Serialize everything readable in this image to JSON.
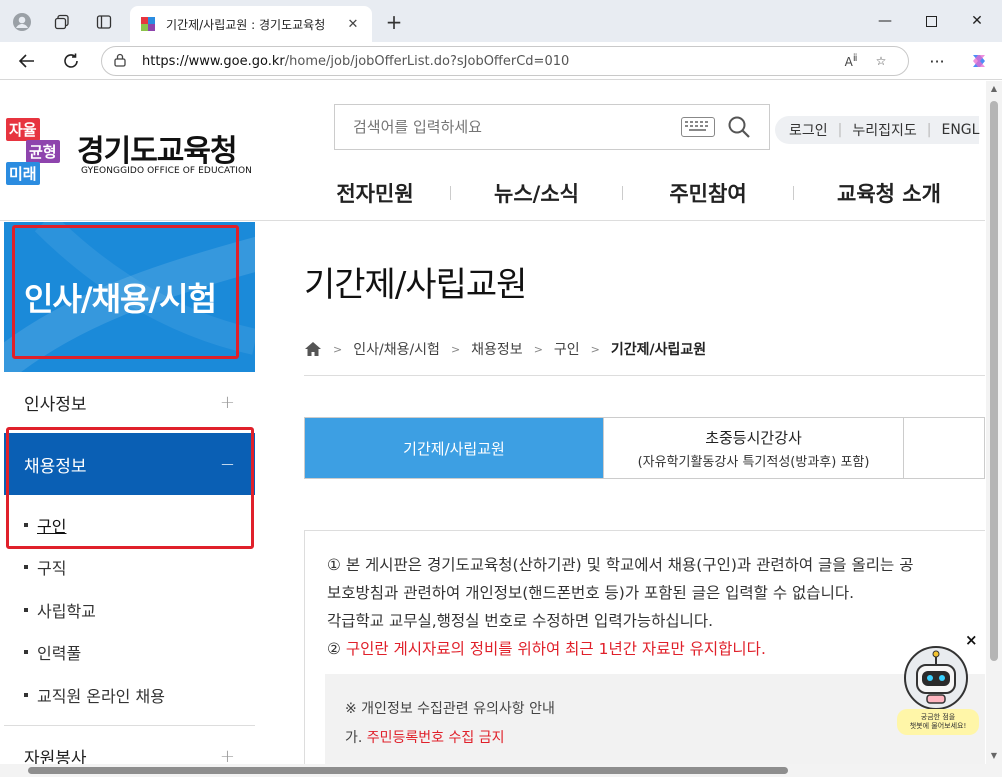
{
  "browser": {
    "tab_title": "기간제/사립교원 : 경기도교육청",
    "url_host": "https://www.goe.go.kr",
    "url_path": "/home/job/jobOfferList.do?sJobOfferCd=010"
  },
  "header": {
    "logo_badge": [
      "자율",
      "균형",
      "미래"
    ],
    "logo_name": "경기도교육청",
    "logo_english": "GYEONGGIDO OFFICE OF EDUCATION",
    "search_placeholder": "검색어를 입력하세요",
    "util_links": [
      "로그인",
      "누리집지도",
      "ENGL"
    ],
    "gnb": [
      "전자민원",
      "뉴스/소식",
      "주민참여",
      "교육청 소개"
    ]
  },
  "sidebar": {
    "title": "인사/채용/시험",
    "items": [
      {
        "label": "인사정보",
        "toggle": "+"
      },
      {
        "label": "채용정보",
        "toggle": "−"
      }
    ],
    "subitems": [
      "구인",
      "구직",
      "사립학교",
      "인력풀",
      "교직원 온라인 채용"
    ],
    "next_item": {
      "label": "자원봉사",
      "toggle": "+"
    }
  },
  "content": {
    "page_title": "기간제/사립교원",
    "breadcrumb": [
      "인사/채용/시험",
      "채용정보",
      "구인",
      "기간제/사립교원"
    ],
    "tabs": [
      {
        "label": "기간제/사립교원",
        "sub": ""
      },
      {
        "label": "초중등시간강사",
        "sub": "(자유학기활동강사 특기적성(방과후) 포함)"
      }
    ],
    "notice_lines": [
      "① 본 게시판은 경기도교육청(산하기관) 및 학교에서 채용(구인)과 관련하여 글을 올리는 공",
      "보호방침과 관련하여 개인정보(핸드폰번호 등)가 포함된 글은 입력할 수 없습니다.",
      "각급학교 교무실,행정실 번호로 수정하면 입력가능하십니다."
    ],
    "notice_red_prefix": "② ",
    "notice_red": "구인란 게시자료의 정비를 위하여 최근 1년간 자료만 유지합니다.",
    "inner_title": "※ 개인정보 수집관련 유의사항 안내",
    "inner_line_prefix": "가. ",
    "inner_line_red": "주민등록번호 수집 금지"
  },
  "chatbot": {
    "close": "×",
    "bubble_line1": "궁금한 점을",
    "bubble_line2": "챗봇에 물어보세요!"
  },
  "colors": {
    "brand_blue": "#1b8ad9",
    "active_nav": "#0a5fb4",
    "tab_active": "#3d9fe3",
    "highlight_red": "#e0202a"
  }
}
